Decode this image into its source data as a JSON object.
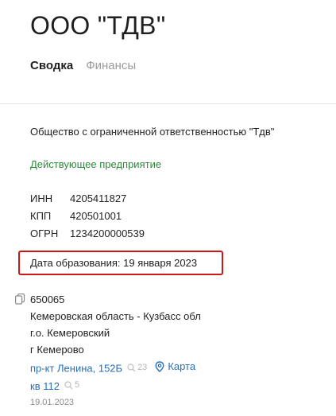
{
  "header": {
    "title": "ООО \"ТДВ\"",
    "tabs": [
      {
        "label": "Сводка",
        "active": true
      },
      {
        "label": "Финансы",
        "active": false
      }
    ]
  },
  "company": {
    "full_name": "Общество с ограниченной ответственностью \"Тдв\"",
    "status": "Действующее предприятие",
    "codes": [
      {
        "label": "ИНН",
        "value": "4205411827"
      },
      {
        "label": "КПП",
        "value": "420501001"
      },
      {
        "label": "ОГРН",
        "value": "1234200000539"
      }
    ],
    "founded": "Дата образования: 19 января 2023"
  },
  "address": {
    "postcode": "650065",
    "region": "Кемеровская область - Кузбасс обл",
    "district": "г.о. Кемеровский",
    "city": "г Кемерово",
    "street": "пр-кт Ленина, 152Б",
    "street_count": "23",
    "map_label": "Карта",
    "apartment": "кв 112",
    "apartment_count": "5",
    "date": "19.01.2023"
  },
  "colors": {
    "status_green": "#2e8a3b",
    "link_blue": "#2a6eb5",
    "highlight_red": "#cc1515"
  },
  "icons": [
    "copy-icon",
    "search-icon",
    "map-pin-icon"
  ]
}
